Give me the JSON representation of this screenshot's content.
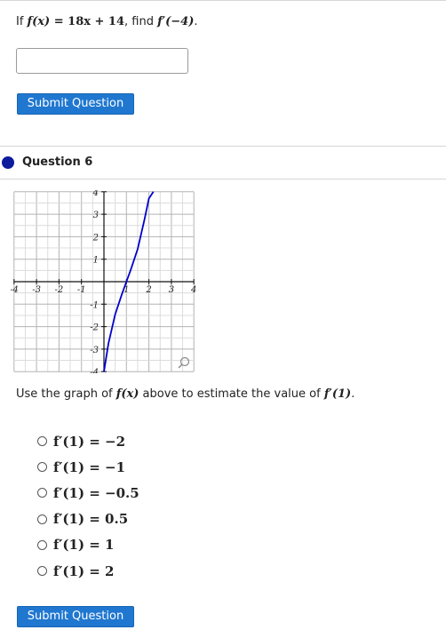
{
  "q5": {
    "prefix": "If ",
    "f_of_x": "f(x)",
    "equation_rhs": " = 18x + 14",
    "find_word": ", find ",
    "target": "f′(−4)",
    "end": ".",
    "submit_label": "Submit Question"
  },
  "q6": {
    "title": "Question 6",
    "prompt_a": "Use the graph of ",
    "prompt_f": "f(x)",
    "prompt_b": " above to estimate the value of ",
    "prompt_target": "f′(1)",
    "prompt_end": ".",
    "options": [
      "f′(1) = −2",
      "f′(1) = −1",
      "f′(1) = −0.5",
      "f′(1) = 0.5",
      "f′(1) = 1",
      "f′(1) = 2"
    ],
    "submit_label": "Submit Question",
    "graph": {
      "x_ticks": [
        "-4",
        "-3",
        "-2",
        "-1",
        "1",
        "2",
        "3",
        "4"
      ],
      "y_ticks": [
        "4",
        "3",
        "2",
        "1",
        "-1",
        "-2",
        "-3",
        "-4"
      ],
      "curve_color": "#0000cc",
      "icon": "magnifier-icon"
    }
  },
  "chart_data": {
    "type": "line",
    "xlim": [
      -4,
      4
    ],
    "ylim": [
      -4,
      4
    ],
    "grid": true,
    "series": [
      {
        "x": [
          0,
          0.2,
          0.5,
          0.8,
          1.0,
          1.2,
          1.5,
          1.8,
          2.0,
          2.2
        ],
        "y": [
          -4.0,
          -2.75,
          -1.45,
          -0.55,
          0.0,
          0.55,
          1.45,
          2.75,
          3.7,
          4.0
        ]
      }
    ]
  }
}
